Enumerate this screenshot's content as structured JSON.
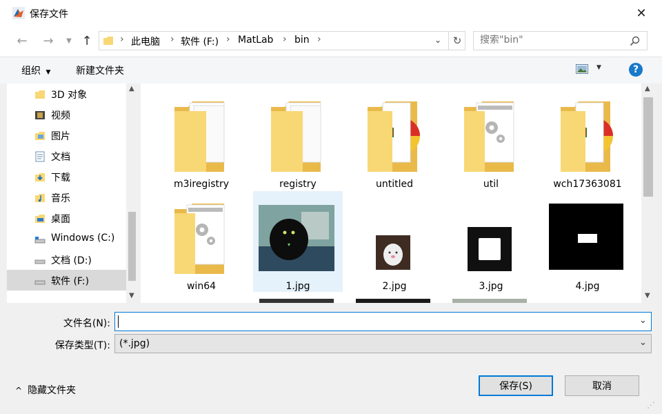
{
  "window": {
    "title": "保存文件"
  },
  "nav": {
    "breadcrumbs": [
      "此电脑",
      "软件 (F:)",
      "MatLab",
      "bin"
    ],
    "search_placeholder": "搜索\"bin\""
  },
  "toolbar": {
    "organize_label": "组织",
    "new_folder_label": "新建文件夹"
  },
  "sidebar": {
    "items": [
      {
        "label": "3D 对象",
        "icon": "3d-objects-icon"
      },
      {
        "label": "视频",
        "icon": "video-icon"
      },
      {
        "label": "图片",
        "icon": "pictures-icon"
      },
      {
        "label": "文档",
        "icon": "documents-icon"
      },
      {
        "label": "下载",
        "icon": "download-icon"
      },
      {
        "label": "音乐",
        "icon": "music-icon"
      },
      {
        "label": "桌面",
        "icon": "desktop-icon"
      },
      {
        "label": "Windows (C:)",
        "icon": "drive-icon"
      },
      {
        "label": "文档 (D:)",
        "icon": "drive-icon"
      },
      {
        "label": "软件 (F:)",
        "icon": "drive-icon",
        "selected": true
      }
    ]
  },
  "files": [
    {
      "name": "m3iregistry",
      "kind": "folder-docs"
    },
    {
      "name": "registry",
      "kind": "folder-docs"
    },
    {
      "name": "untitled",
      "kind": "folder-media"
    },
    {
      "name": "util",
      "kind": "folder-gear"
    },
    {
      "name": "wch17363081",
      "kind": "folder-media"
    },
    {
      "name": "win64",
      "kind": "folder-gear"
    },
    {
      "name": "1.jpg",
      "kind": "image",
      "selected": true
    },
    {
      "name": "2.jpg",
      "kind": "image"
    },
    {
      "name": "3.jpg",
      "kind": "image"
    },
    {
      "name": "4.jpg",
      "kind": "image"
    }
  ],
  "form": {
    "filename_label": "文件名(N):",
    "filename_value": "",
    "filetype_label": "保存类型(T):",
    "filetype_value": "(*.jpg)"
  },
  "footer": {
    "hide_folders_label": "隐藏文件夹",
    "save_label": "保存(S)",
    "cancel_label": "取消"
  },
  "colors": {
    "accent": "#0078d7",
    "folder": "#f8d775",
    "selection": "#e5f1fb",
    "help": "#1979ca"
  }
}
